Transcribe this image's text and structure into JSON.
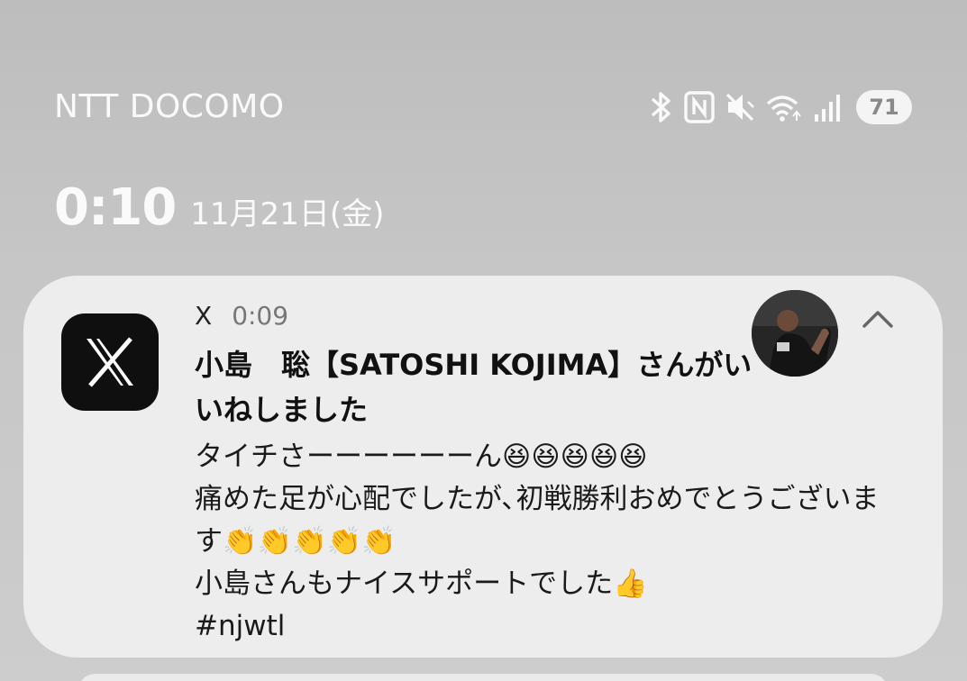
{
  "status_bar": {
    "carrier": "NTT DOCOMO",
    "battery": "71",
    "icons": [
      "bluetooth-icon",
      "nfc-icon",
      "mute-vibrate-icon",
      "wifi-icon",
      "signal-icon"
    ]
  },
  "lockscreen": {
    "time": "0:10",
    "date": "11月21日(金)"
  },
  "notification": {
    "app_name": "X",
    "time": "0:09",
    "title": "小島　聡【SATOSHI KOJIMA】さんがいいねしました",
    "body_lines": [
      "タイチさーーーーーーん😆😆😆😆😆",
      "痛めた足が心配でしたが､初戦勝利おめでとうございま",
      "す👏👏👏👏👏",
      "小島さんもナイスサポートでした👍",
      "#njwtl"
    ],
    "colors": {
      "card": "#eeeeee",
      "app_icon_bg": "#0f0f0f"
    }
  }
}
